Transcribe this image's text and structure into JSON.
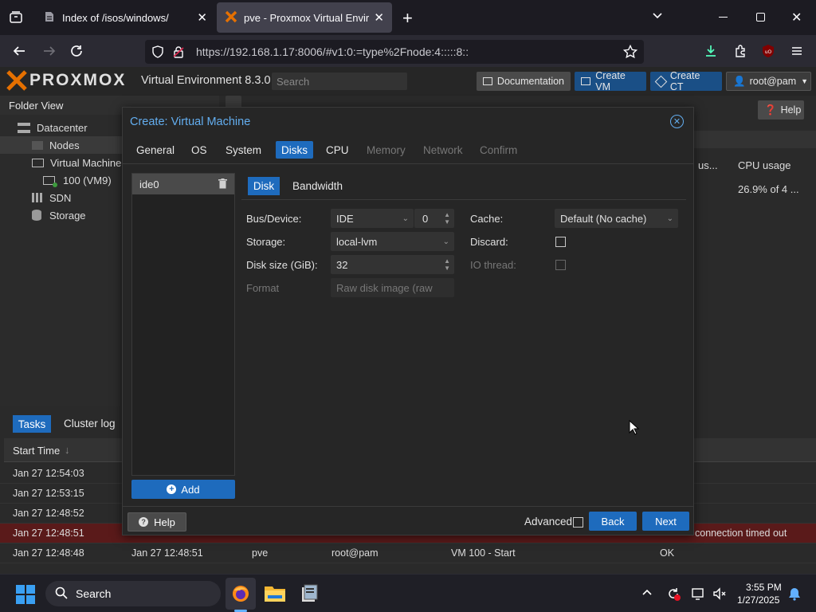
{
  "browser": {
    "tabs": [
      {
        "label": "Index of /isos/windows/",
        "active": false
      },
      {
        "label": "pve - Proxmox Virtual Environme",
        "active": true
      }
    ],
    "url": "https://192.168.1.17:8006/#v1:0:=type%2Fnode:4:::::8::"
  },
  "pve": {
    "logo": "PROXMOX",
    "version": "Virtual Environment 8.3.0",
    "search_placeholder": "Search",
    "buttons": {
      "documentation": "Documentation",
      "create_vm": "Create VM",
      "create_ct": "Create CT",
      "user": "root@pam",
      "help": "Help"
    },
    "folder_view": "Folder View",
    "tree": {
      "datacenter": "Datacenter",
      "nodes": "Nodes",
      "vms": "Virtual Machine",
      "vm": "100 (VM9)",
      "sdn": "SDN",
      "storage": "Storage"
    },
    "right_cols": {
      "partial": "us...",
      "cpu_usage": "CPU usage",
      "cpu_value": "26.9% of 4 ..."
    },
    "bottom_tabs": {
      "tasks": "Tasks",
      "cluster_log": "Cluster log"
    },
    "log_header": {
      "start_time": "Start Time"
    },
    "log_rows": [
      {
        "start": "Jan 27 12:54:03"
      },
      {
        "start": "Jan 27 12:53:15"
      },
      {
        "start": "Jan 27 12:48:52"
      },
      {
        "start": "Jan 27 12:48:51",
        "status": "connection timed out",
        "error": true
      },
      {
        "start": "Jan 27 12:48:48",
        "end": "Jan 27 12:48:51",
        "node": "pve",
        "user": "root@pam",
        "desc": "VM 100 - Start",
        "status": "OK"
      }
    ]
  },
  "dialog": {
    "title": "Create: Virtual Machine",
    "tabs": [
      {
        "label": "General",
        "state": "normal"
      },
      {
        "label": "OS",
        "state": "normal"
      },
      {
        "label": "System",
        "state": "normal"
      },
      {
        "label": "Disks",
        "state": "active"
      },
      {
        "label": "CPU",
        "state": "normal"
      },
      {
        "label": "Memory",
        "state": "disabled"
      },
      {
        "label": "Network",
        "state": "disabled"
      },
      {
        "label": "Confirm",
        "state": "disabled"
      }
    ],
    "disk_item": "ide0",
    "add_label": "Add",
    "subtabs": {
      "disk": "Disk",
      "bandwidth": "Bandwidth"
    },
    "form": {
      "bus_label": "Bus/Device:",
      "bus_value": "IDE",
      "bus_index": "0",
      "storage_label": "Storage:",
      "storage_value": "local-lvm",
      "size_label": "Disk size (GiB):",
      "size_value": "32",
      "format_label": "Format",
      "format_value": "Raw disk image (raw",
      "cache_label": "Cache:",
      "cache_value": "Default (No cache)",
      "discard_label": "Discard:",
      "iothread_label": "IO thread:"
    },
    "footer": {
      "help": "Help",
      "advanced": "Advanced",
      "back": "Back",
      "next": "Next"
    }
  },
  "taskbar": {
    "search": "Search",
    "time": "3:55 PM",
    "date": "1/27/2025"
  }
}
